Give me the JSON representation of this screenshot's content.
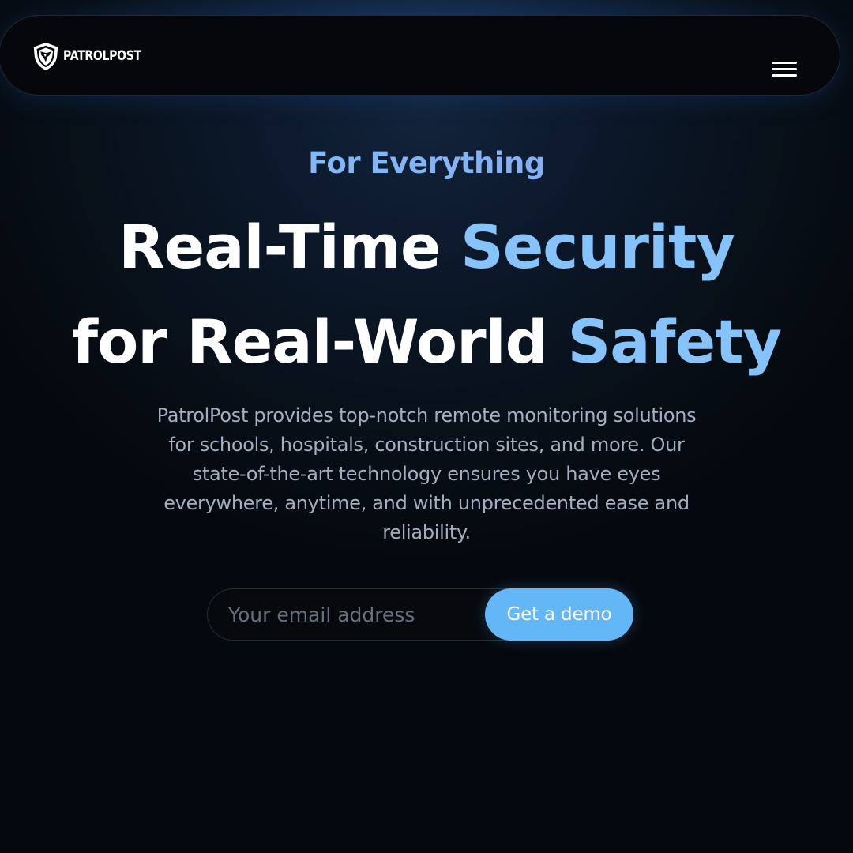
{
  "header": {
    "brand_name": "PATROLPOST",
    "logo_icon": "shield-logo-icon",
    "menu_icon": "hamburger-menu-icon"
  },
  "hero": {
    "eyebrow": "For Everything",
    "headline_line1_part1": "Real-Time ",
    "headline_line1_accent": "Security",
    "headline_line2_part1": "for Real-World ",
    "headline_line2_accent": "Safety",
    "description_lines": [
      "PatrolPost provides top-notch remote monitoring solutions",
      "for schools, hospitals, construction sites, and more. Our",
      "state-of-the-art technology ensures you have eyes",
      "everywhere, anytime, and with unprecedented ease and",
      "reliability."
    ]
  },
  "form": {
    "email_placeholder": "Your email address",
    "email_value": "",
    "submit_label": "Get a demo"
  },
  "colors": {
    "accent": "#86c3fb",
    "button": "#64b7f7",
    "background": "#05080e"
  }
}
